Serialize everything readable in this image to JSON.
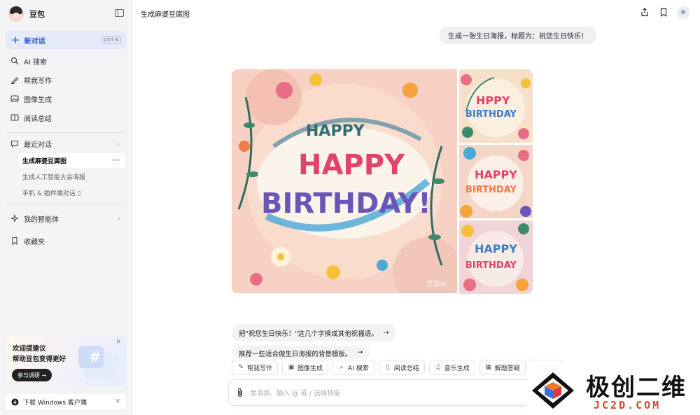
{
  "sidebar": {
    "brand": "豆包",
    "new_chat": {
      "label": "新对话",
      "shortcut": "Ctrl K"
    },
    "nav": [
      {
        "label": "AI 搜索",
        "icon": "ai-search-icon"
      },
      {
        "label": "帮我写作",
        "icon": "pen-icon"
      },
      {
        "label": "图像生成",
        "icon": "image-icon"
      },
      {
        "label": "阅读总结",
        "icon": "book-icon"
      }
    ],
    "recent": {
      "label": "最近对话",
      "items": [
        {
          "label": "生成麻婆豆腐图",
          "active": true
        },
        {
          "label": "生成人工智能大会海报",
          "active": false
        },
        {
          "label": "手机 & 插件端对话 ▯",
          "active": false
        }
      ]
    },
    "agents": "我的智能体",
    "favorites": "收藏夹",
    "promo": {
      "line1": "欢迎提建议",
      "line2": "帮助豆包变得更好",
      "button": "参与调研 →"
    },
    "download": "下载 Windows 客户端"
  },
  "header": {
    "title": "生成麻婆豆腐图"
  },
  "conversation": {
    "user_message": "生成一张生日海报，标题为：祝您生日快乐！",
    "image_text": {
      "small": "HAPPY",
      "line1": "HAPPY",
      "line2": "BIRTHDAY!",
      "watermark": "豆包AI"
    },
    "side_images": [
      {
        "line1": "HPPY",
        "line2": "BIRTHDAY"
      },
      {
        "line1": "HAPPY",
        "line2": "BIRTHDAY"
      },
      {
        "line1": "HAPPY",
        "line2": "BIRTHDAY"
      }
    ],
    "suggestions": [
      "把\"祝您生日快乐！\"这几个字换成其他祝福语。",
      "推荐一些适合做生日海报的背景模板。"
    ]
  },
  "tools": [
    {
      "label": "帮我写作",
      "icon": "pen-icon"
    },
    {
      "label": "图像生成",
      "icon": "image-icon"
    },
    {
      "label": "AI 搜索",
      "icon": "ai-search-icon"
    },
    {
      "label": "阅读总结",
      "icon": "book-icon"
    },
    {
      "label": "音乐生成",
      "icon": "music-icon"
    },
    {
      "label": "解题答疑",
      "icon": "calculator-icon"
    },
    {
      "label": "更多",
      "icon": "grid-icon"
    }
  ],
  "composer": {
    "placeholder": "发消息、输入 @ 或 / 选择技能"
  },
  "watermark": {
    "text": "极创二维",
    "sub": "JC2D.COM"
  },
  "colors": {
    "accent": "#2d5ddb",
    "sidebar_bg": "#f3f4f6",
    "bubble": "#eef0f4"
  }
}
